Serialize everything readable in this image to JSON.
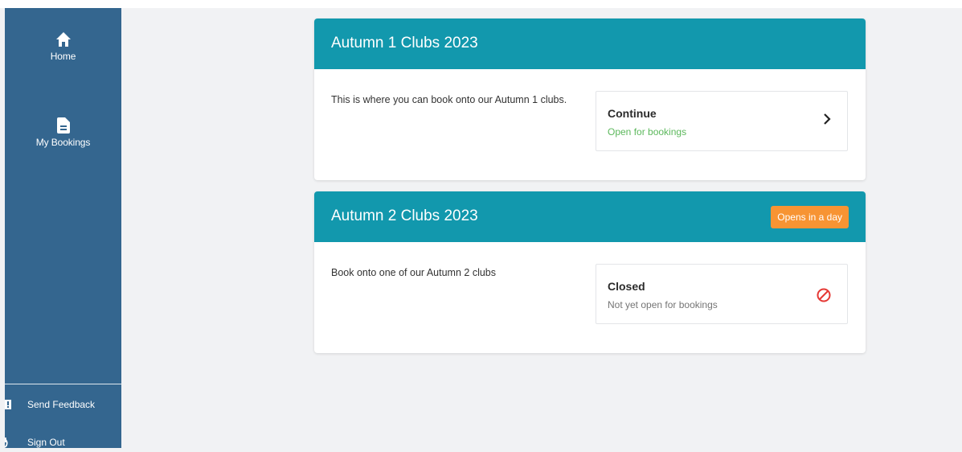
{
  "sidebar": {
    "items": [
      {
        "label": "Home",
        "icon": "home-icon"
      },
      {
        "label": "My Bookings",
        "icon": "document-icon"
      }
    ],
    "bottom": [
      {
        "label": "Send Feedback",
        "icon": "feedback-icon"
      },
      {
        "label": "Sign Out",
        "icon": "power-icon"
      }
    ]
  },
  "cards": [
    {
      "title": "Autumn 1 Clubs 2023",
      "badge": "",
      "description": "This is where you can book onto our Autumn 1 clubs.",
      "action_title": "Continue",
      "action_status": "Open for bookings",
      "status_color": "#5cb85c",
      "action_icon": "chevron-right-icon"
    },
    {
      "title": "Autumn 2 Clubs 2023",
      "badge": "Opens in a day",
      "description": "Book onto one of our Autumn 2 clubs",
      "action_title": "Closed",
      "action_status": "Not yet open for bookings",
      "status_color": "#757575",
      "action_icon": "blocked-icon"
    }
  ],
  "colors": {
    "sidebar": "#34668f",
    "card_header": "#1298ad",
    "badge": "#f79433",
    "blocked": "#e53935"
  }
}
